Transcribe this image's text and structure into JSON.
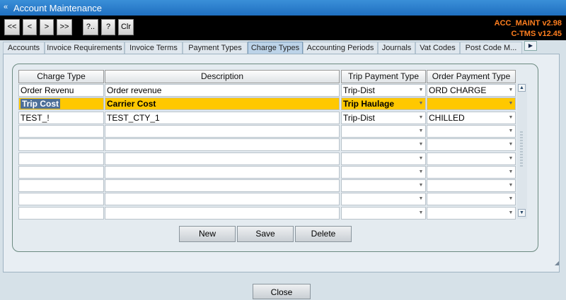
{
  "window": {
    "title": "Account Maintenance",
    "icon": "double-chevron-icon"
  },
  "toolbar": {
    "buttons": [
      "<<",
      "<",
      ">",
      ">>",
      "?..",
      "?",
      "Clr"
    ],
    "version_line1": "ACC_MAINT v2.98",
    "version_line2": "C-TMS v12.45"
  },
  "tabs": [
    "Accounts",
    "Invoice Requirements",
    "Invoice Terms",
    "Payment Types",
    "Charge Types",
    "Accounting Periods",
    "Journals",
    "Vat Codes",
    "Post Code M..."
  ],
  "active_tab": "Charge Types",
  "table": {
    "headers": [
      "Charge Type",
      "Description",
      "Trip Payment Type",
      "Order Payment Type"
    ],
    "rows": [
      {
        "charge_type": "Order Revenu",
        "description": "Order revenue",
        "trip_payment": "Trip-Dist",
        "order_payment": "ORD CHARGE"
      },
      {
        "charge_type": "Trip Cost",
        "description": "Carrier Cost",
        "trip_payment": "Trip Haulage",
        "order_payment": ""
      },
      {
        "charge_type": "TEST_!",
        "description": "TEST_CTY_1",
        "trip_payment": "Trip-Dist",
        "order_payment": "CHILLED"
      },
      {
        "charge_type": "",
        "description": "",
        "trip_payment": "",
        "order_payment": ""
      },
      {
        "charge_type": "",
        "description": "",
        "trip_payment": "",
        "order_payment": ""
      },
      {
        "charge_type": "",
        "description": "",
        "trip_payment": "",
        "order_payment": ""
      },
      {
        "charge_type": "",
        "description": "",
        "trip_payment": "",
        "order_payment": ""
      },
      {
        "charge_type": "",
        "description": "",
        "trip_payment": "",
        "order_payment": ""
      },
      {
        "charge_type": "",
        "description": "",
        "trip_payment": "",
        "order_payment": ""
      },
      {
        "charge_type": "",
        "description": "",
        "trip_payment": "",
        "order_payment": ""
      }
    ],
    "selected_row": 1
  },
  "actions": {
    "new": "New",
    "save": "Save",
    "delete": "Delete"
  },
  "footer": {
    "close": "Close"
  },
  "colors": {
    "title_bar": "#2b7fcf",
    "selected_row": "#ffc800",
    "version_text": "#ff7f1f"
  }
}
